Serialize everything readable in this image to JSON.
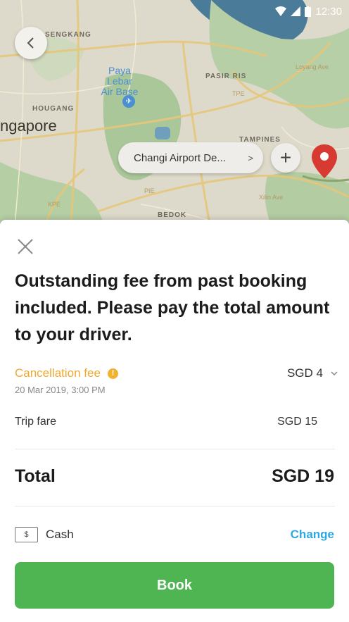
{
  "status_bar": {
    "time": "12:30"
  },
  "map": {
    "labels": {
      "sengkang": "SENGKANG",
      "paya_lebar": "Paya Lebar",
      "air_base": "Air Base",
      "pasir_ris": "PASIR RIS",
      "hougang": "HOUGANG",
      "singapore": "ngapore",
      "tampines": "TAMPINES",
      "bedok": "BEDOK",
      "tpe": "TPE",
      "pie": "PIE",
      "kpe": "KPE",
      "loyang": "Loyang Ave",
      "xilin": "Xilin Ave"
    },
    "pickup": {
      "label": "Changi Airport De...",
      "chevron": ">"
    },
    "plus_label": "+"
  },
  "sheet": {
    "headline": "Outstanding fee from past booking included. Please pay the total amount to your driver.",
    "cancellation": {
      "label": "Cancellation fee",
      "info_glyph": "!",
      "amount": "SGD 4",
      "date": "20 Mar 2019, 3:00 PM"
    },
    "trip_fare": {
      "label": "Trip fare",
      "amount": "SGD 15"
    },
    "total": {
      "label": "Total",
      "amount": "SGD 19"
    },
    "payment": {
      "icon_glyph": "$",
      "method": "Cash",
      "change_label": "Change"
    },
    "book_label": "Book"
  },
  "colors": {
    "accent_orange": "#f0a830",
    "link_blue": "#2ea8e0",
    "book_green": "#4fb553",
    "pin_red": "#d63a30"
  },
  "icons": {
    "back": "chevron-left-icon",
    "close": "close-icon",
    "info": "info-icon",
    "expand": "chevron-down-icon",
    "cash": "cash-icon",
    "pin": "location-pin-icon"
  }
}
